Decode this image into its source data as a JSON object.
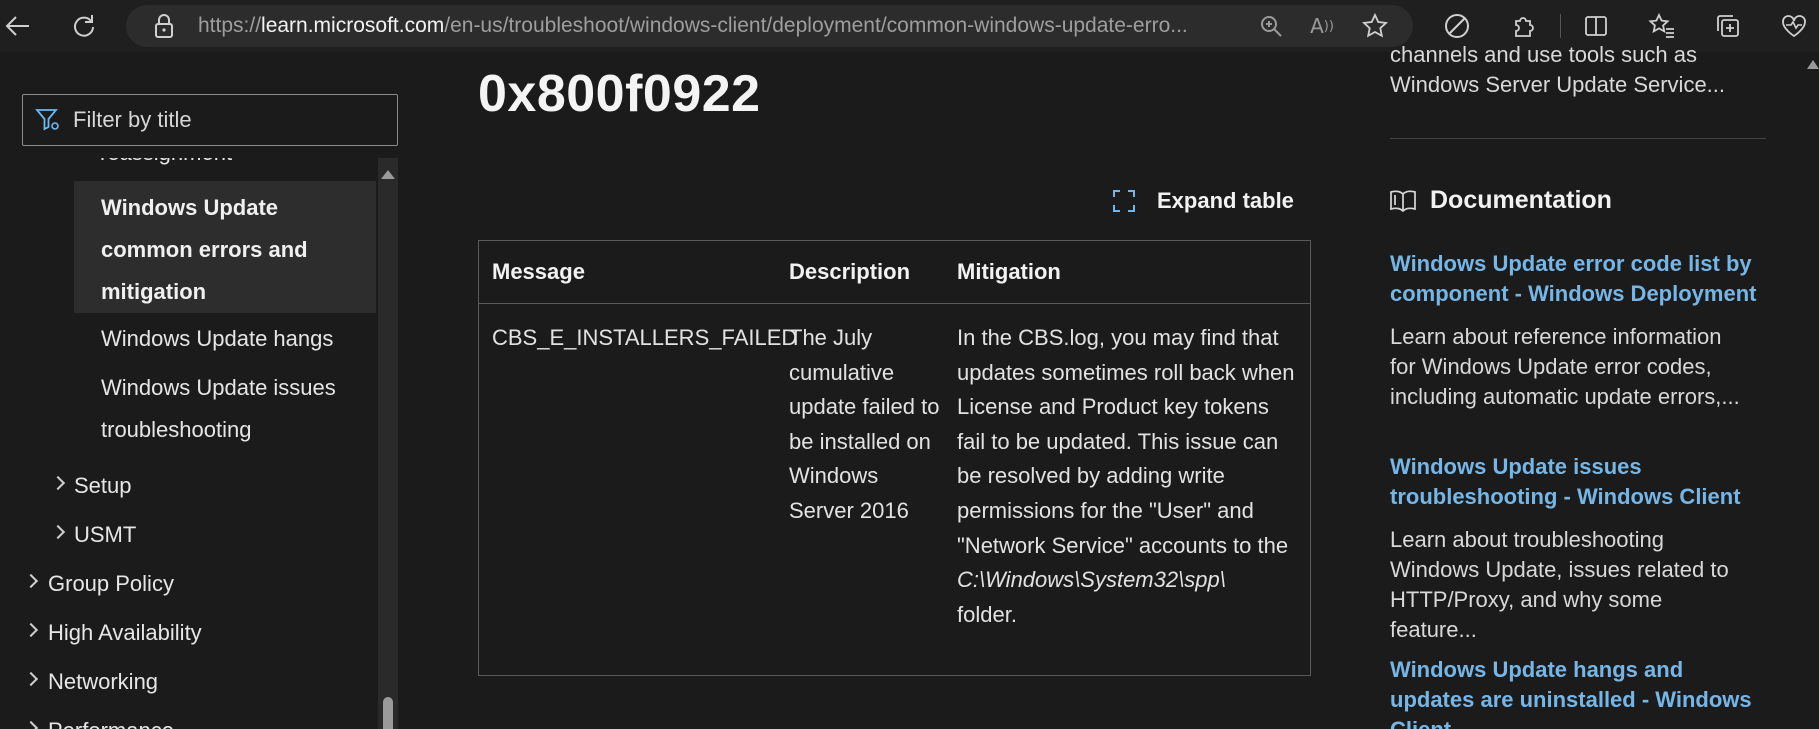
{
  "browser": {
    "url_scheme": "https://",
    "url_host": "learn.microsoft.com",
    "url_path": "/en-us/troubleshoot/windows-client/deployment/common-windows-update-erro..."
  },
  "sidebar": {
    "filter_placeholder": "Filter by title",
    "partial_item": "reassignment",
    "selected_item": "Windows Update common errors and mitigation",
    "items": [
      {
        "label": "Windows Update hangs"
      },
      {
        "label": "Windows Update issues troubleshooting"
      },
      {
        "label": "Setup"
      },
      {
        "label": "USMT"
      },
      {
        "label": "Group Policy"
      },
      {
        "label": "High Availability"
      },
      {
        "label": "Networking"
      },
      {
        "label": "Performance"
      }
    ]
  },
  "main": {
    "title": "0x800f0922",
    "expand_label": "Expand table",
    "table": {
      "headers": [
        "Message",
        "Description",
        "Mitigation"
      ],
      "row": {
        "message": "CBS_E_INSTALLERS_FAILED",
        "description": "The July cumulative update failed to be installed on Windows Server 2016",
        "mitigation_text": "In the CBS.log, you may find that updates sometimes roll back when License and Product key tokens fail to be updated. This issue can be resolved by adding write permissions for the \"User\" and \"Network Service\" accounts to the",
        "mitigation_path": "C:\\Windows\\System32\\spp\\",
        "mitigation_end": "folder."
      }
    }
  },
  "rail": {
    "partial_text": "channels and use tools such as Windows Server Update Service...",
    "section_title": "Documentation",
    "links": [
      {
        "title": "Windows Update error code list by component - Windows Deployment",
        "desc": "Learn about reference information for Windows Update error codes, including automatic update errors,..."
      },
      {
        "title": "Windows Update issues troubleshooting - Windows Client",
        "desc": "Learn about troubleshooting Windows Update, issues related to HTTP/Proxy, and why some feature..."
      },
      {
        "title": "Windows Update hangs and updates are uninstalled - Windows Client",
        "desc": ""
      }
    ]
  },
  "colors": {
    "link": "#75b6e7",
    "background": "#1b1b1b",
    "nav_selected": "#2d2d2d"
  }
}
